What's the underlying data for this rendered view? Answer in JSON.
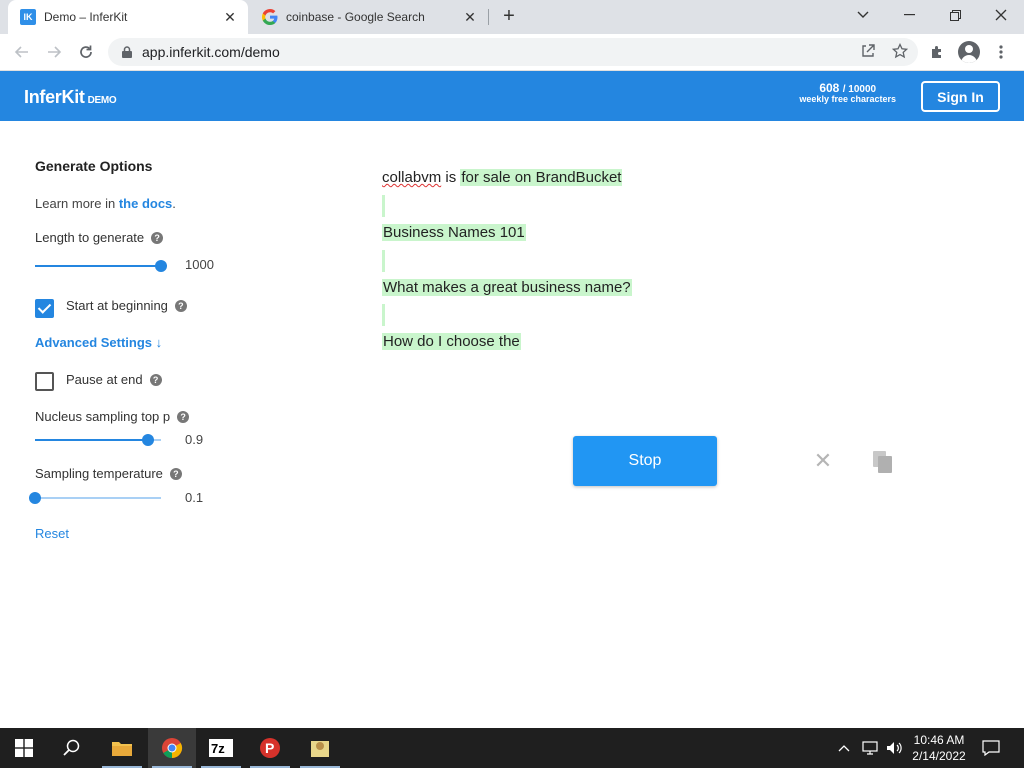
{
  "browser": {
    "tabs": [
      {
        "title": "Demo – InferKit",
        "favicon": "IK"
      },
      {
        "title": "coinbase - Google Search",
        "favicon": "google-g-icon"
      }
    ],
    "url": "app.inferkit.com/demo"
  },
  "header": {
    "brand": "InferKit",
    "brand_suffix": "DEMO",
    "chars_used": "608",
    "chars_total": "/ 10000",
    "chars_caption": "weekly free characters",
    "sign_in": "Sign In"
  },
  "options": {
    "title": "Generate Options",
    "learn_prefix": "Learn more in ",
    "learn_link": "the docs",
    "learn_suffix": ".",
    "length_label": "Length to generate",
    "length_value": "1000",
    "length_fraction": 1.0,
    "start_label": "Start at beginning",
    "start_checked": true,
    "advanced_label": "Advanced Settings ↓",
    "pause_label": "Pause at end",
    "pause_checked": false,
    "nucleus_label": "Nucleus sampling top p",
    "nucleus_value": "0.9",
    "nucleus_fraction": 0.9,
    "temperature_label": "Sampling temperature",
    "temperature_value": "0.1",
    "temperature_fraction": 0.0,
    "reset_label": "Reset"
  },
  "output": {
    "prompt": "collabvm",
    "prompt_join": " is",
    "line1_generated": "for sale on BrandBucket",
    "line2": "Business Names 101",
    "line3": "What makes a great business name?",
    "line4": "How do I choose the"
  },
  "actions": {
    "stop": "Stop"
  },
  "taskbar": {
    "time": "10:46 AM",
    "date": "2/14/2022"
  }
}
